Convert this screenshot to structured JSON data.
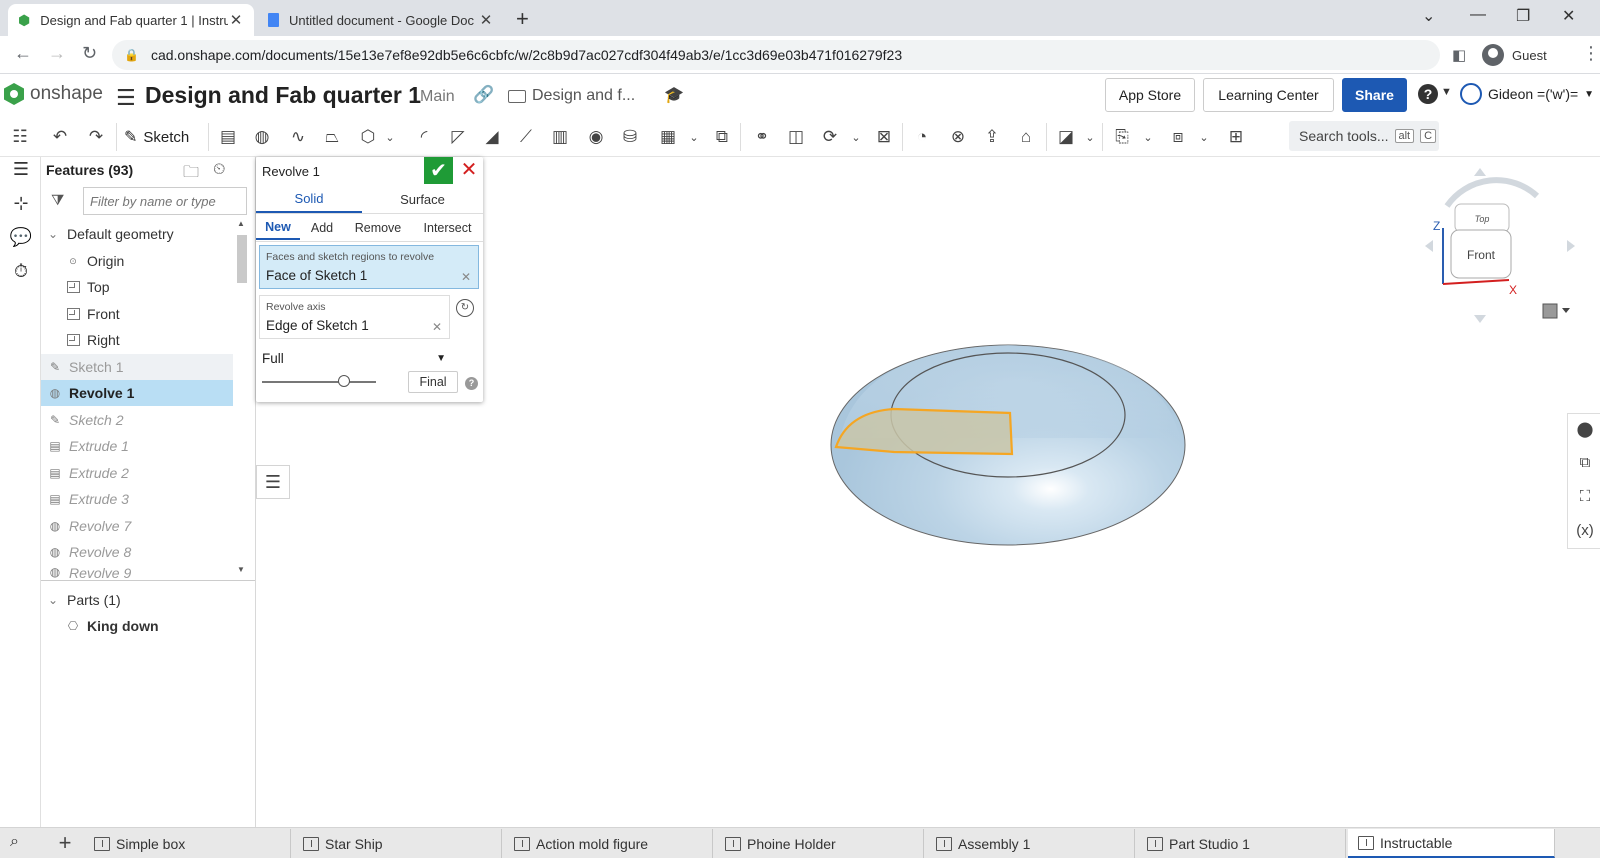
{
  "browser": {
    "tabs": [
      {
        "title": "Design and Fab quarter 1 | Instru",
        "active": true
      },
      {
        "title": "Untitled document - Google Doc",
        "active": false
      }
    ],
    "url": "cad.onshape.com/documents/15e13e7ef8e92db5e6c6cbfc/w/2c8b9d7ac027cdf304f49ab3/e/1cc3d69e03b471f016279f23",
    "profile": "Guest"
  },
  "header": {
    "brand": "onshape",
    "doc_title": "Design and Fab quarter 1",
    "branch": "Main",
    "folder": "Design and f...",
    "app_store": "App Store",
    "learning_center": "Learning Center",
    "share": "Share",
    "user": "Gideon =('w')="
  },
  "toolbar": {
    "sketch": "Sketch",
    "search_placeholder": "Search tools...",
    "shortcut_alt": "alt",
    "shortcut_key": "C"
  },
  "features": {
    "header": "Features (93)",
    "filter_placeholder": "Filter by name or type",
    "default_geometry": "Default geometry",
    "defaults": [
      "Origin",
      "Top",
      "Front",
      "Right"
    ],
    "items": [
      {
        "label": "Sketch 1",
        "kind": "sketch",
        "state": "hover"
      },
      {
        "label": "Revolve 1",
        "kind": "revolve",
        "state": "selected"
      },
      {
        "label": "Sketch 2",
        "kind": "sketch",
        "state": "suppressed"
      },
      {
        "label": "Extrude 1",
        "kind": "extrude",
        "state": "suppressed"
      },
      {
        "label": "Extrude 2",
        "kind": "extrude",
        "state": "suppressed"
      },
      {
        "label": "Extrude 3",
        "kind": "extrude",
        "state": "suppressed"
      },
      {
        "label": "Revolve 7",
        "kind": "revolve",
        "state": "suppressed"
      },
      {
        "label": "Revolve 8",
        "kind": "revolve",
        "state": "suppressed"
      },
      {
        "label": "Revolve 9",
        "kind": "revolve",
        "state": "suppressed"
      }
    ],
    "parts_header": "Parts (1)",
    "parts": [
      "King down"
    ]
  },
  "dialog": {
    "title": "Revolve 1",
    "body_tabs": [
      "Solid",
      "Surface"
    ],
    "op_tabs": [
      "New",
      "Add",
      "Remove",
      "Intersect"
    ],
    "faces_label": "Faces and sketch regions to revolve",
    "faces_value": "Face of Sketch 1",
    "axis_label": "Revolve axis",
    "axis_value": "Edge of Sketch 1",
    "type": "Full",
    "final": "Final"
  },
  "viewcube": {
    "top": "Top",
    "front": "Front",
    "z": "Z",
    "x": "X"
  },
  "bottom_tabs": [
    {
      "label": "Simple box",
      "active": false
    },
    {
      "label": "Star Ship",
      "active": false
    },
    {
      "label": "Action mold figure",
      "active": false
    },
    {
      "label": "Phoine Holder",
      "active": false
    },
    {
      "label": "Assembly 1",
      "active": false
    },
    {
      "label": "Part Studio 1",
      "active": false
    },
    {
      "label": "Instructable",
      "active": true
    }
  ],
  "colors": {
    "accent": "#1d59b3",
    "selected_row": "#b9def4",
    "confirm": "#1f9b36",
    "cancel": "#d31f1f",
    "model_fill": "#bcd4e6",
    "sketch_highlight": "#f5a623"
  }
}
